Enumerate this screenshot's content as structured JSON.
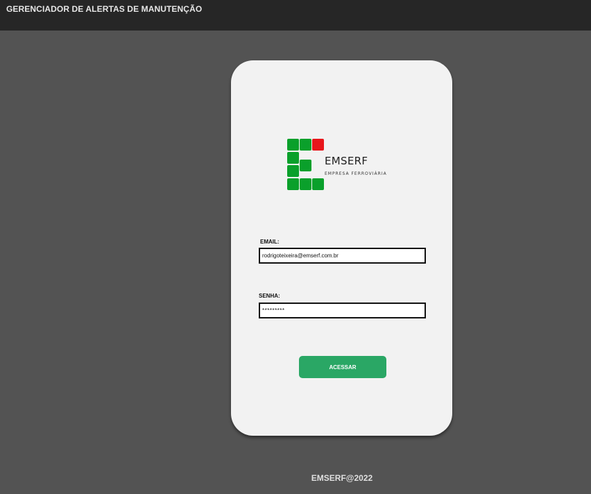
{
  "header": {
    "title": "GERENCIADOR DE ALERTAS DE MANUTENÇÃO"
  },
  "logo": {
    "name": "EMSERF",
    "tagline": "EMPRESA FERROVIÁRIA",
    "colors": {
      "green": "#0aa02b",
      "red": "#e8161b"
    }
  },
  "login": {
    "email_label": "EMAIL:",
    "email_value": "rodrigoteixeira@emserf.com.br",
    "password_label": "SENHA:",
    "password_value": "*********",
    "submit_label": "ACESSAR"
  },
  "footer": {
    "text": "EMSERF@2022"
  },
  "colors": {
    "background": "#535353",
    "topbar": "#262626",
    "card": "#f2f2f2",
    "button": "#2aa765"
  }
}
